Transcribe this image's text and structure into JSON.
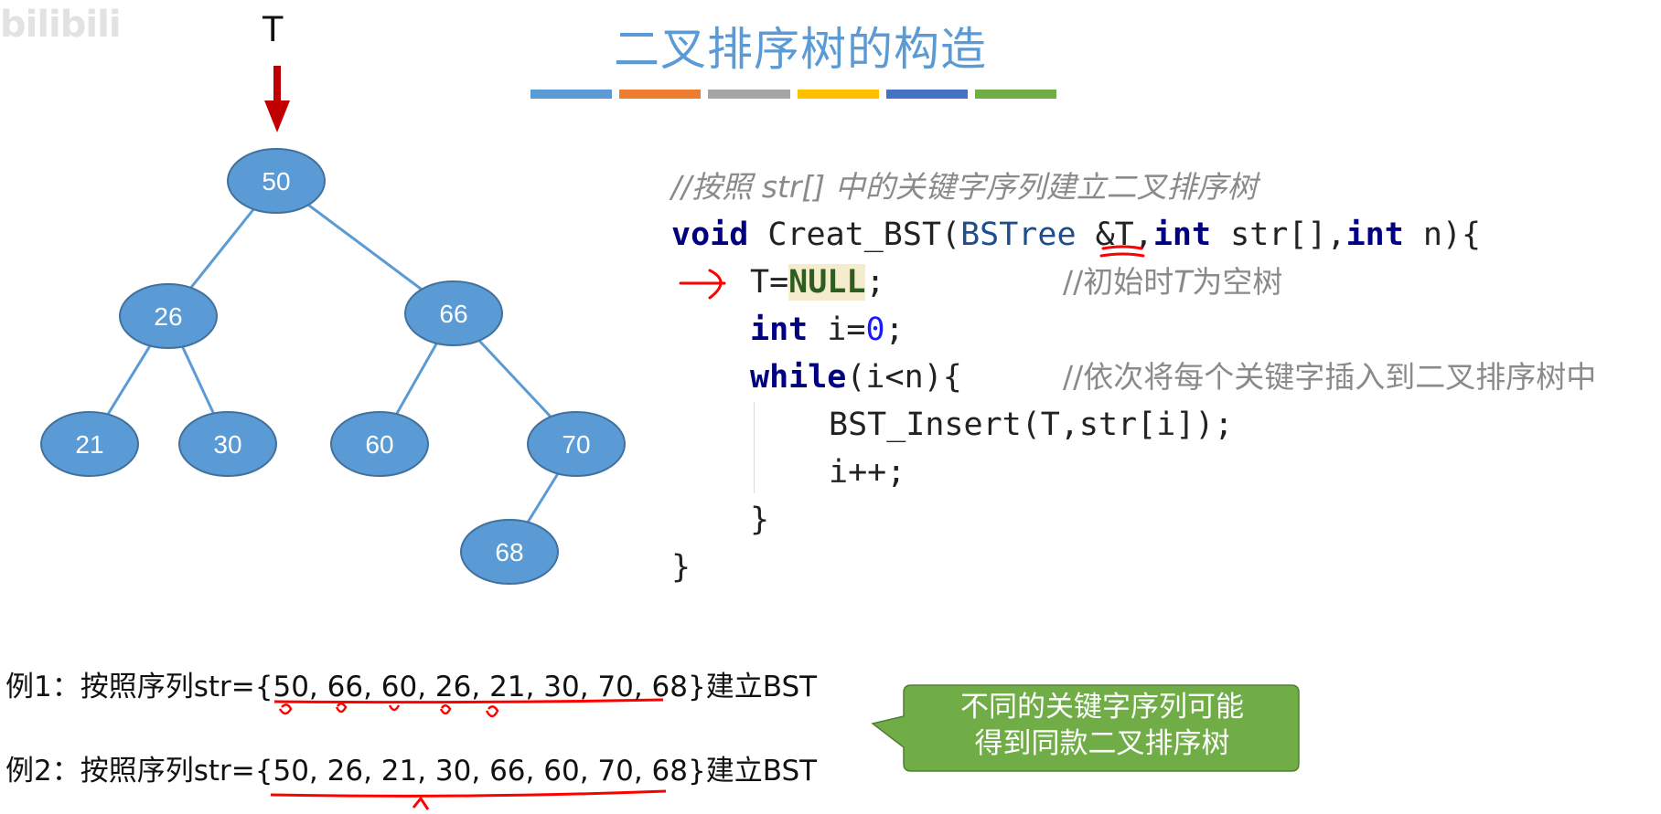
{
  "watermark": "bilibili",
  "root_label": "T",
  "title": "二叉排序树的构造",
  "color_bar": [
    "#5b9bd5",
    "#ed7d31",
    "#a5a5a5",
    "#ffc000",
    "#4472c4",
    "#70ad47"
  ],
  "colors": {
    "node_fill": "#5b9bd5",
    "node_stroke": "#41719c",
    "edge": "#5b9bd5",
    "arrow": "#c00000",
    "annotation_red": "#ff0000",
    "callout_fill": "#70ad47"
  },
  "tree": {
    "nodes": [
      {
        "id": "n50",
        "label": "50"
      },
      {
        "id": "n26",
        "label": "26"
      },
      {
        "id": "n66",
        "label": "66"
      },
      {
        "id": "n21",
        "label": "21"
      },
      {
        "id": "n30",
        "label": "30"
      },
      {
        "id": "n60",
        "label": "60"
      },
      {
        "id": "n70",
        "label": "70"
      },
      {
        "id": "n68",
        "label": "68"
      }
    ],
    "edges": [
      [
        "n50",
        "n26"
      ],
      [
        "n50",
        "n66"
      ],
      [
        "n26",
        "n21"
      ],
      [
        "n26",
        "n30"
      ],
      [
        "n66",
        "n60"
      ],
      [
        "n66",
        "n70"
      ],
      [
        "n70",
        "n68"
      ]
    ]
  },
  "code": {
    "line1": "//按照 str[] 中的关键字序列建立二叉排序树",
    "line2_kw": "void",
    "line2_name": " Creat_BST(",
    "line2_type": "BSTree",
    "line2_ref": " &T,",
    "line2_kw2": "int",
    "line2_mid": " str[],",
    "line2_kw3": "int",
    "line2_end": " n){",
    "line3_a": "T=",
    "line3_null": "NULL",
    "line3_b": ";",
    "line3_comment_a": "//初始时",
    "line3_comment_t": "T",
    "line3_comment_b": "为空树",
    "line4_kw": "int",
    "line4_a": " i=",
    "line4_num": "0",
    "line4_b": ";",
    "line5_kw": "while",
    "line5_a": "(i<n){",
    "line5_comment": "//依次将每个关键字插入到二叉排序树中",
    "line6": "BST_Insert(T,str[i]);",
    "line7": "i++;",
    "line8": "}",
    "line9": "}"
  },
  "examples": {
    "ex1": "例1：按照序列str={50, 66, 60, 26, 21, 30, 70, 68}建立BST",
    "ex2": "例2：按照序列str={50, 26, 21, 30, 66, 60, 70, 68}建立BST"
  },
  "callout": {
    "line1": "不同的关键字序列可能",
    "line2": "得到同款二叉排序树"
  }
}
